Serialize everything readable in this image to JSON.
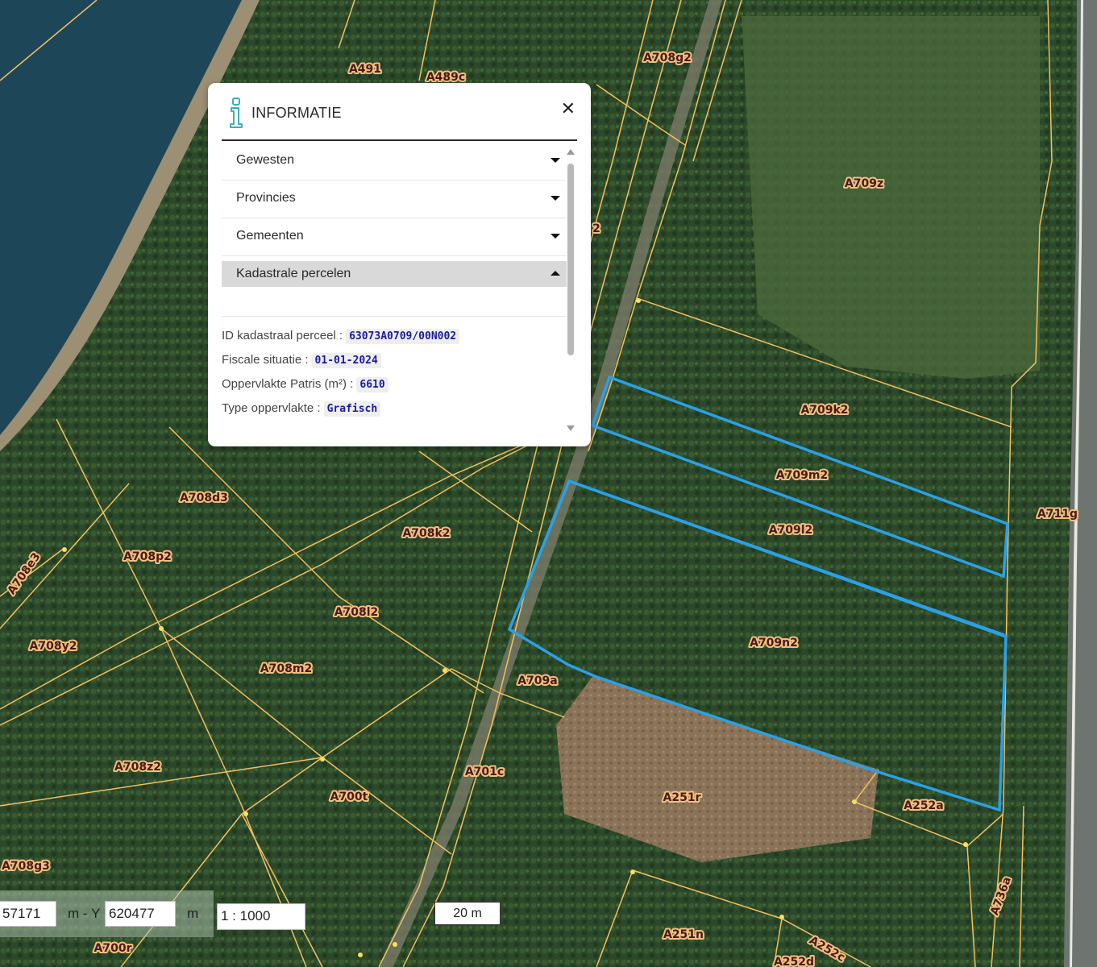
{
  "map": {
    "parcel_labels": [
      "A491",
      "A489c",
      "A708g2",
      "A709z",
      "A709k2",
      "A709m2",
      "A709l2",
      "A709n2",
      "A711g",
      "A708d3",
      "A708k2",
      "A708p2",
      "A708e3",
      "A708l2",
      "A708y2",
      "A708m2",
      "A709a",
      "A708z2",
      "A701c",
      "A700t",
      "A251r",
      "A252a",
      "A708g3",
      "A700r",
      "A251n",
      "A736a",
      "A252c",
      "A252d",
      "2"
    ],
    "colors": {
      "parcel_lines": "#f2c060",
      "selection_outline": "#2aa0e8",
      "water": "#1e4a5c",
      "forest": "#2f4a2a"
    }
  },
  "popup": {
    "title": "INFORMATIE",
    "icon": "info-icon",
    "close_icon": "close-icon",
    "sections": [
      {
        "label": "Gewesten",
        "state": "collapsed"
      },
      {
        "label": "Provincies",
        "state": "collapsed"
      },
      {
        "label": "Gemeenten",
        "state": "collapsed"
      },
      {
        "label": "Kadastrale percelen",
        "state": "expanded"
      }
    ],
    "details": {
      "id_label": "ID kadastraal perceel :",
      "id_value": "63073A0709/00N002",
      "fiscal_label": "Fiscale situatie :",
      "fiscal_value": "01-01-2024",
      "area_label": "Oppervlakte Patris (m²) :",
      "area_value": "6610",
      "type_label": "Type oppervlakte :",
      "type_value": "Grafisch"
    }
  },
  "controls": {
    "x_value": "57171",
    "sep_text": "m - Y",
    "y_value": "620477",
    "unit": "m",
    "scale_value": "1 : 1000",
    "scale_bar": "20 m"
  }
}
